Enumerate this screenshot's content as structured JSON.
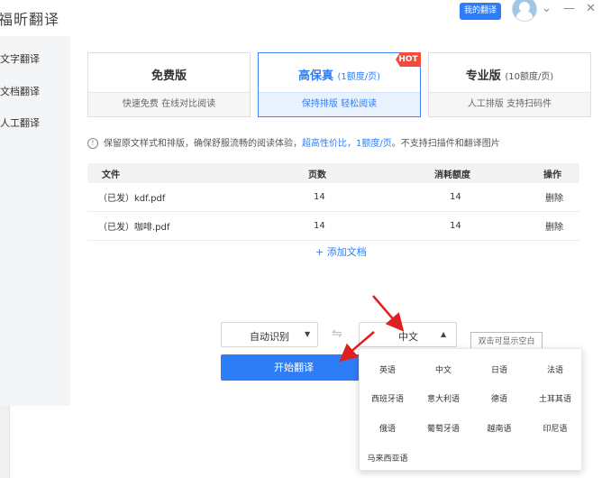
{
  "window": {
    "title": "福昕翻译",
    "my_translate_button": "我的翻译",
    "chevron_glyph": "⌄",
    "minimize_glyph": "—",
    "close_glyph": "✕"
  },
  "sidebar": {
    "items": [
      {
        "label": "文字翻译"
      },
      {
        "label": "文档翻译"
      },
      {
        "label": "人工翻译"
      }
    ]
  },
  "plans": [
    {
      "title": "免费版",
      "price": "",
      "subtitle": "快速免费 在线对比阅读",
      "active": false
    },
    {
      "title": "高保真",
      "price": "(1额度/页)",
      "subtitle": "保持排版 轻松阅读",
      "active": true,
      "badge": "HOT"
    },
    {
      "title": "专业版",
      "price": "(10额度/页)",
      "subtitle": "人工排版 支持扫码件",
      "active": false
    }
  ],
  "notice": {
    "icon": "!",
    "part1": "保留原文样式和排版，确保舒服流畅的阅读体验，",
    "highlight": "超高性价比，1额度/页",
    "part2": "。不支持扫描件和翻译图片"
  },
  "table": {
    "headers": [
      "文件",
      "页数",
      "消耗额度",
      "操作"
    ],
    "rows": [
      {
        "file": "（已发）kdf.pdf",
        "pages": "14",
        "cost": "14",
        "action": "删除"
      },
      {
        "file": "（已发）咖啡.pdf",
        "pages": "14",
        "cost": "14",
        "action": "删除"
      }
    ]
  },
  "add_document": "+ 添加文档",
  "source_language": {
    "value": "自动识别",
    "caret": "▼"
  },
  "swap_glyph": "⇋",
  "target_language": {
    "value": "中文",
    "caret": "▲"
  },
  "start_button": "开始翻译",
  "hint_box": "双击可显示空白",
  "language_options": [
    "英语",
    "中文",
    "日语",
    "法语",
    "西班牙语",
    "意大利语",
    "德语",
    "土耳其语",
    "俄语",
    "葡萄牙语",
    "越南语",
    "印尼语",
    "马来西亚语"
  ],
  "colors": {
    "accent": "#2d7df6",
    "hot_badge": "#f24c3d",
    "annotation_arrow": "#e02020"
  }
}
